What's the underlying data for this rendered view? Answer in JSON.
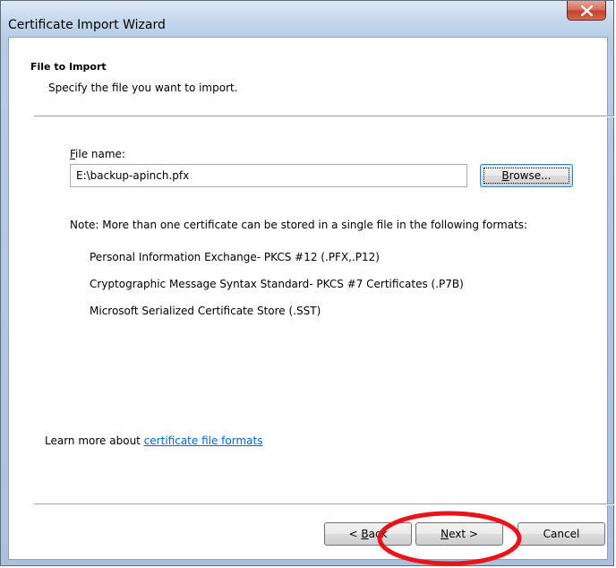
{
  "window": {
    "title": "Certificate Import Wizard",
    "close_label": "x"
  },
  "header": {
    "title": "File to Import",
    "subtitle": "Specify the file you want to import."
  },
  "form": {
    "file_label_accel": "F",
    "file_label_rest": "ile name:",
    "file_value": "E:\\backup-apinch.pfx",
    "browse_accel": "B",
    "browse_rest": "rowse..."
  },
  "note": {
    "text": "Note:  More than one certificate can be stored in a single file in the following formats:",
    "formats": [
      "Personal Information Exchange- PKCS #12 (.PFX,.P12)",
      "Cryptographic Message Syntax Standard- PKCS #7 Certificates (.P7B)",
      "Microsoft Serialized Certificate Store (.SST)"
    ]
  },
  "learn_more": {
    "prefix": "Learn more about ",
    "link": "certificate file formats"
  },
  "footer": {
    "back_prefix": "< ",
    "back_accel": "B",
    "back_rest": "ack",
    "next_accel": "N",
    "next_rest": "ext >",
    "cancel_label": "Cancel"
  },
  "colors": {
    "highlight": "#e8141a",
    "link": "#0066cc"
  }
}
